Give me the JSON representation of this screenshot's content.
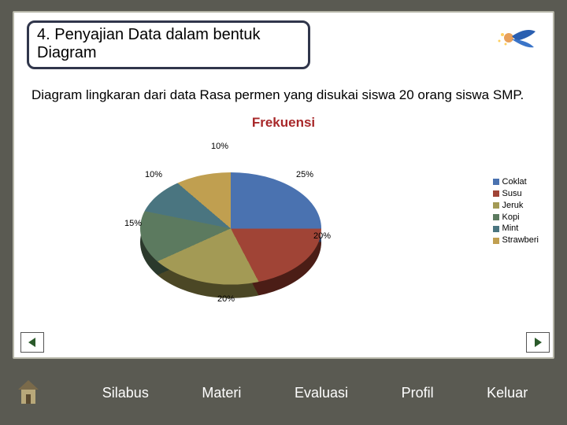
{
  "title": "4. Penyajian Data dalam bentuk Diagram",
  "description": "Diagram lingkaran dari data Rasa permen yang disukai siswa 20 orang siswa SMP.",
  "chart_data": {
    "type": "pie",
    "title": "Frekuensi",
    "series": [
      {
        "name": "Coklat",
        "pct": 25,
        "label": "25%",
        "color": "#4a72b0"
      },
      {
        "name": "Susu",
        "pct": 20,
        "label": "20%",
        "color": "#a04436"
      },
      {
        "name": "Jeruk",
        "pct": 20,
        "label": "20%",
        "color": "#a39a55"
      },
      {
        "name": "Kopi",
        "pct": 15,
        "label": "15%",
        "color": "#5c7a5f"
      },
      {
        "name": "Mint",
        "pct": 10,
        "label": "10%",
        "color": "#4a7580"
      },
      {
        "name": "Strawberi",
        "pct": 10,
        "label": "10%",
        "color": "#c09f50"
      }
    ],
    "legend_position": "right"
  },
  "menu": {
    "silabus": "Silabus",
    "materi": "Materi",
    "evaluasi": "Evaluasi",
    "profil": "Profil",
    "keluar": "Keluar"
  }
}
